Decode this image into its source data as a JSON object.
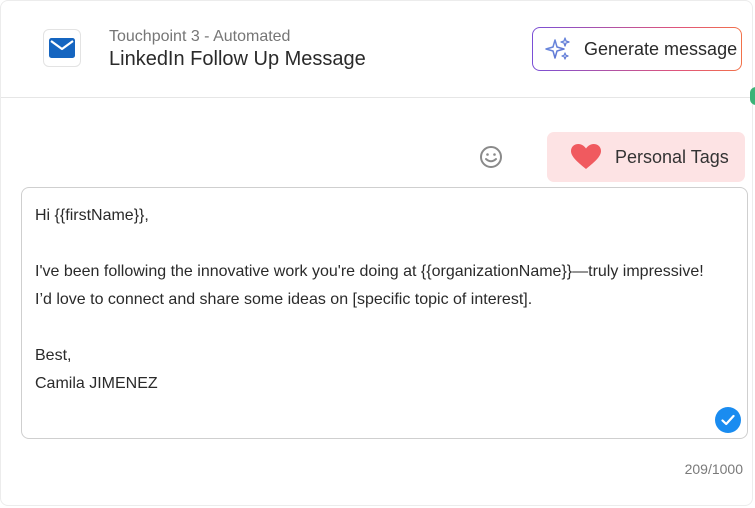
{
  "header": {
    "subtitle": "Touchpoint 3 - Automated",
    "title": "LinkedIn Follow Up Message",
    "icon": "envelope-icon",
    "generate_button": {
      "label": "Generate message",
      "icon": "sparkle-icon"
    }
  },
  "toolbar": {
    "emoji_icon": "smiley-icon",
    "personal_tags": {
      "label": "Personal Tags",
      "icon": "heart-icon"
    }
  },
  "editor": {
    "lines": [
      "Hi {{firstName}},",
      "",
      "I've been following the innovative work you're doing at {{organizationName}}—truly impressive! I’d love to connect and share some ideas on [specific topic of interest].",
      "",
      "Best,",
      "Camila JIMENEZ"
    ],
    "valid_icon": "check-circle-icon"
  },
  "char_counter": "209/1000",
  "colors": {
    "accent_blue": "#1a8cf0",
    "envelope_blue": "#1565c0",
    "tag_bg": "#fde3e4",
    "heart_red": "#f05a5f",
    "gradient_start": "#7a4fd6",
    "gradient_end": "#f2724a"
  }
}
